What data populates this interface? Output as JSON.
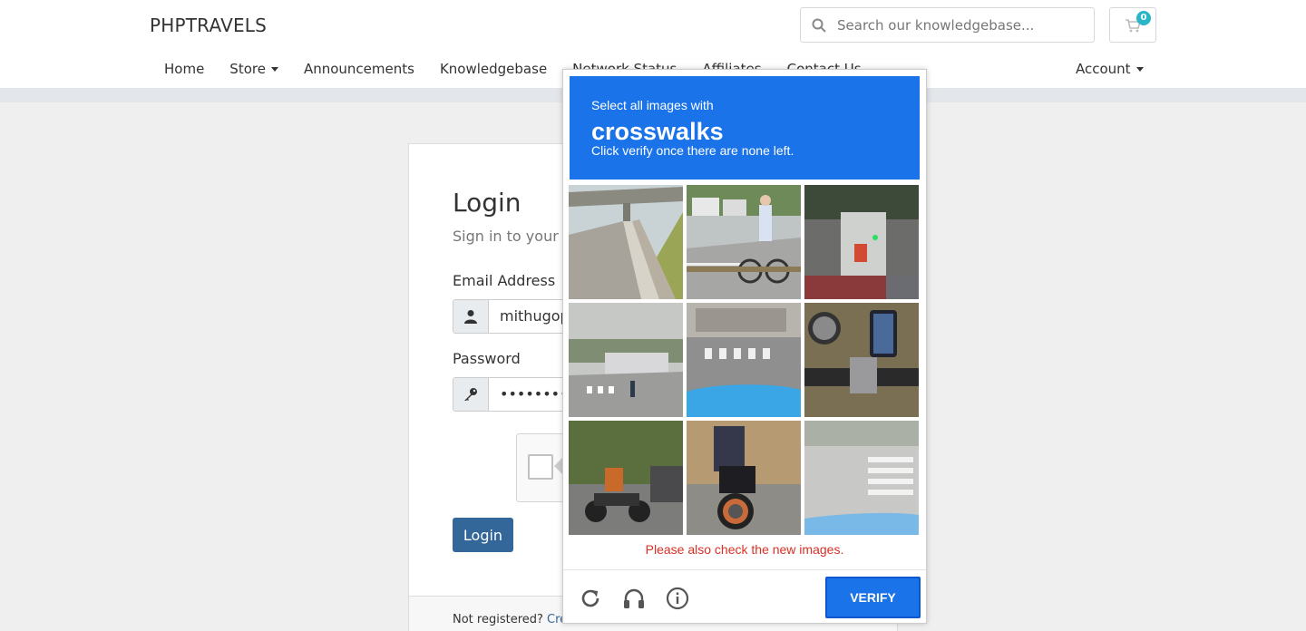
{
  "header": {
    "brand": "PHPTRAVELS",
    "search_placeholder": "Search our knowledgebase...",
    "cart_count": "0",
    "nav": [
      {
        "label": "Home"
      },
      {
        "label": "Store"
      },
      {
        "label": "Announcements"
      },
      {
        "label": "Knowledgebase"
      },
      {
        "label": "Network Status"
      },
      {
        "label": "Affiliates"
      },
      {
        "label": "Contact Us"
      }
    ],
    "account_label": "Account"
  },
  "login": {
    "title": "Login",
    "subtitle": "Sign in to your a",
    "email_label": "Email Address",
    "email_value": "mithugop",
    "password_label": "Password",
    "password_value": "••••••••••",
    "button_label": "Login",
    "footer_text": "Not registered? ",
    "footer_link": "Crea"
  },
  "captcha": {
    "instruction_1": "Select all images with",
    "target": "crosswalks",
    "instruction_2": "Click verify once there are none left.",
    "warning": "Please also check the new images.",
    "verify_label": "VERIFY",
    "header_color": "#1a73e8",
    "tiles": [
      {
        "name": "tile-overpass-road"
      },
      {
        "name": "tile-cyclist-street"
      },
      {
        "name": "tile-traffic-light"
      },
      {
        "name": "tile-parking-crosswalk"
      },
      {
        "name": "tile-crosswalk-car-hood"
      },
      {
        "name": "tile-motorbike-phone"
      },
      {
        "name": "tile-motorbike-trees"
      },
      {
        "name": "tile-motorbike-rider"
      },
      {
        "name": "tile-crosswalk-road"
      }
    ]
  }
}
